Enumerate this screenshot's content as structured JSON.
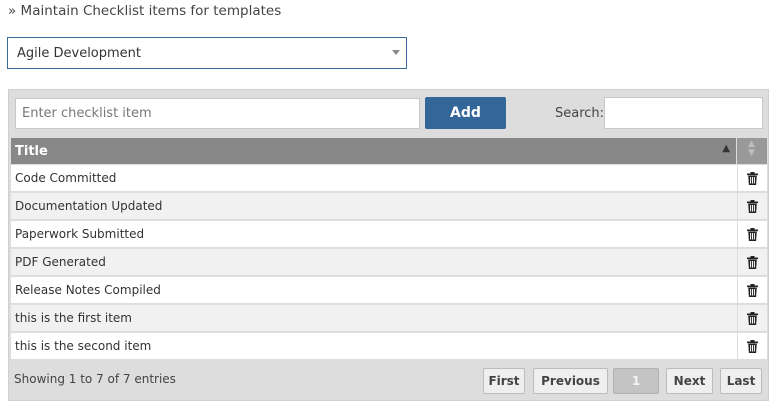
{
  "page": {
    "heading": "» Maintain Checklist items for templates"
  },
  "template_select": {
    "value": "Agile Development"
  },
  "toolbar": {
    "item_placeholder": "Enter checklist item",
    "add_label": "Add",
    "search_label": "Search:",
    "search_value": ""
  },
  "table": {
    "columns": [
      "Title",
      ""
    ],
    "rows": [
      {
        "title": "Code Committed"
      },
      {
        "title": "Documentation Updated"
      },
      {
        "title": "Paperwork Submitted"
      },
      {
        "title": "PDF Generated"
      },
      {
        "title": "Release Notes Compiled"
      },
      {
        "title": "this is the first item"
      },
      {
        "title": "this is the second item"
      }
    ],
    "row_action_icon": "trash-icon"
  },
  "footer": {
    "info": "Showing 1 to 7 of 7 entries",
    "first": "First",
    "previous": "Previous",
    "current_page": "1",
    "next": "Next",
    "last": "Last"
  },
  "colors": {
    "accent": "#336699",
    "header_bg": "#888888",
    "panel_bg": "#dddddd"
  }
}
